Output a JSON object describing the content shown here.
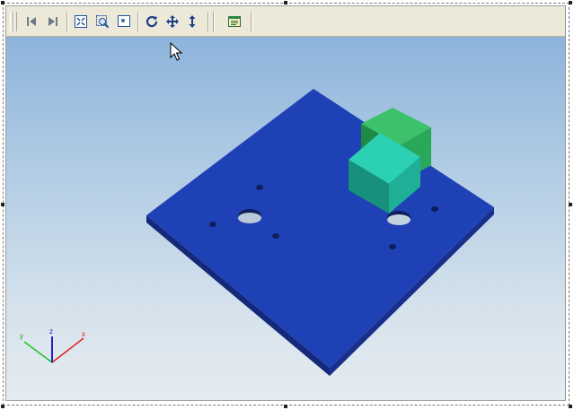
{
  "window": {
    "title": ""
  },
  "toolbar": {
    "buttons": [
      {
        "name": "first-frame-button",
        "icon": "skip-to-start-icon"
      },
      {
        "name": "last-frame-button",
        "icon": "skip-to-end-icon"
      },
      {
        "name": "fit-all-button",
        "icon": "fit-all-icon"
      },
      {
        "name": "zoom-window-button",
        "icon": "zoom-window-icon"
      },
      {
        "name": "zoom-area-button",
        "icon": "zoom-area-icon"
      },
      {
        "name": "rotate-button",
        "icon": "rotate-icon"
      },
      {
        "name": "pan-button",
        "icon": "pan-icon"
      },
      {
        "name": "zoom-button",
        "icon": "vertical-arrow-icon"
      },
      {
        "name": "properties-button",
        "icon": "properties-icon"
      }
    ]
  },
  "scene": {
    "plate_color": "#1f41b6",
    "cube_back_color": "#2aa85a",
    "cube_front_color": "#22c0a4",
    "background_top": "#8db4dc",
    "background_bottom": "#e6ecf0"
  },
  "axes": {
    "x_label": "x",
    "y_label": "y",
    "z_label": "z",
    "x_color": "#e02020",
    "y_color": "#20c020",
    "z_color": "#2020c0"
  }
}
